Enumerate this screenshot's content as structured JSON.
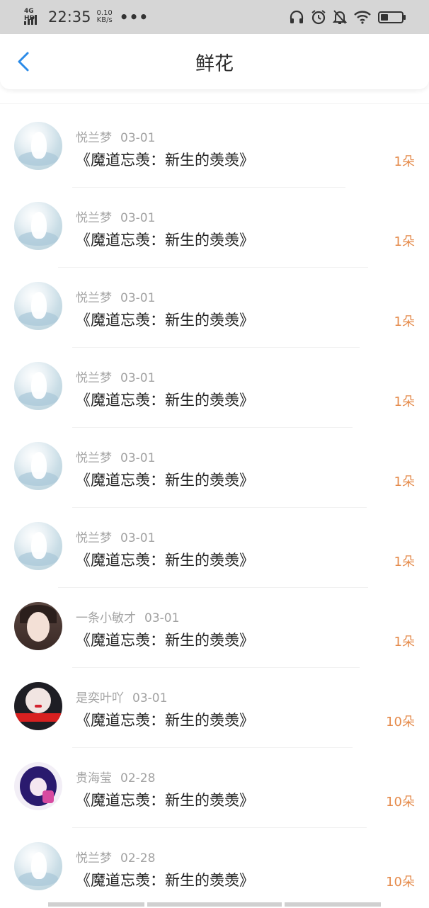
{
  "status_bar": {
    "network": "4G HD",
    "time": "22:35",
    "speed_value": "0.10",
    "speed_unit": "KB/s",
    "more": "•••",
    "icons": [
      "headphones-icon",
      "alarm-icon",
      "mute-icon",
      "wifi-icon",
      "battery-icon"
    ]
  },
  "navbar": {
    "back_icon": "chevron-left-icon",
    "title": "鲜花"
  },
  "accent_colors": {
    "back": "#2c8be8",
    "count": "#e58a4a"
  },
  "items": [
    {
      "user": "悦兰梦",
      "date": "03-01",
      "title": "《魔道忘羡：新生的羡羡》",
      "count": "1朵",
      "avatar": "white-swan-avatar"
    },
    {
      "user": "悦兰梦",
      "date": "03-01",
      "title": "《魔道忘羡：新生的羡羡》",
      "count": "1朵",
      "avatar": "white-swan-avatar"
    },
    {
      "user": "悦兰梦",
      "date": "03-01",
      "title": "《魔道忘羡：新生的羡羡》",
      "count": "1朵",
      "avatar": "white-swan-avatar"
    },
    {
      "user": "悦兰梦",
      "date": "03-01",
      "title": "《魔道忘羡：新生的羡羡》",
      "count": "1朵",
      "avatar": "white-swan-avatar"
    },
    {
      "user": "悦兰梦",
      "date": "03-01",
      "title": "《魔道忘羡：新生的羡羡》",
      "count": "1朵",
      "avatar": "white-swan-avatar"
    },
    {
      "user": "悦兰梦",
      "date": "03-01",
      "title": "《魔道忘羡：新生的羡羡》",
      "count": "1朵",
      "avatar": "white-swan-avatar"
    },
    {
      "user": "一条小敏才",
      "date": "03-01",
      "title": "《魔道忘羡：新生的羡羡》",
      "count": "1朵",
      "avatar": "girl-photo-avatar"
    },
    {
      "user": "是奕叶吖",
      "date": "03-01",
      "title": "《魔道忘羡：新生的羡羡》",
      "count": "10朵",
      "avatar": "red-lips-avatar"
    },
    {
      "user": "贵海莹",
      "date": "02-28",
      "title": "《魔道忘羡：新生的羡羡》",
      "count": "10朵",
      "avatar": "anime-girl-avatar"
    },
    {
      "user": "悦兰梦",
      "date": "02-28",
      "title": "《魔道忘羡：新生的羡羡》",
      "count": "10朵",
      "avatar": "white-swan-avatar"
    }
  ]
}
